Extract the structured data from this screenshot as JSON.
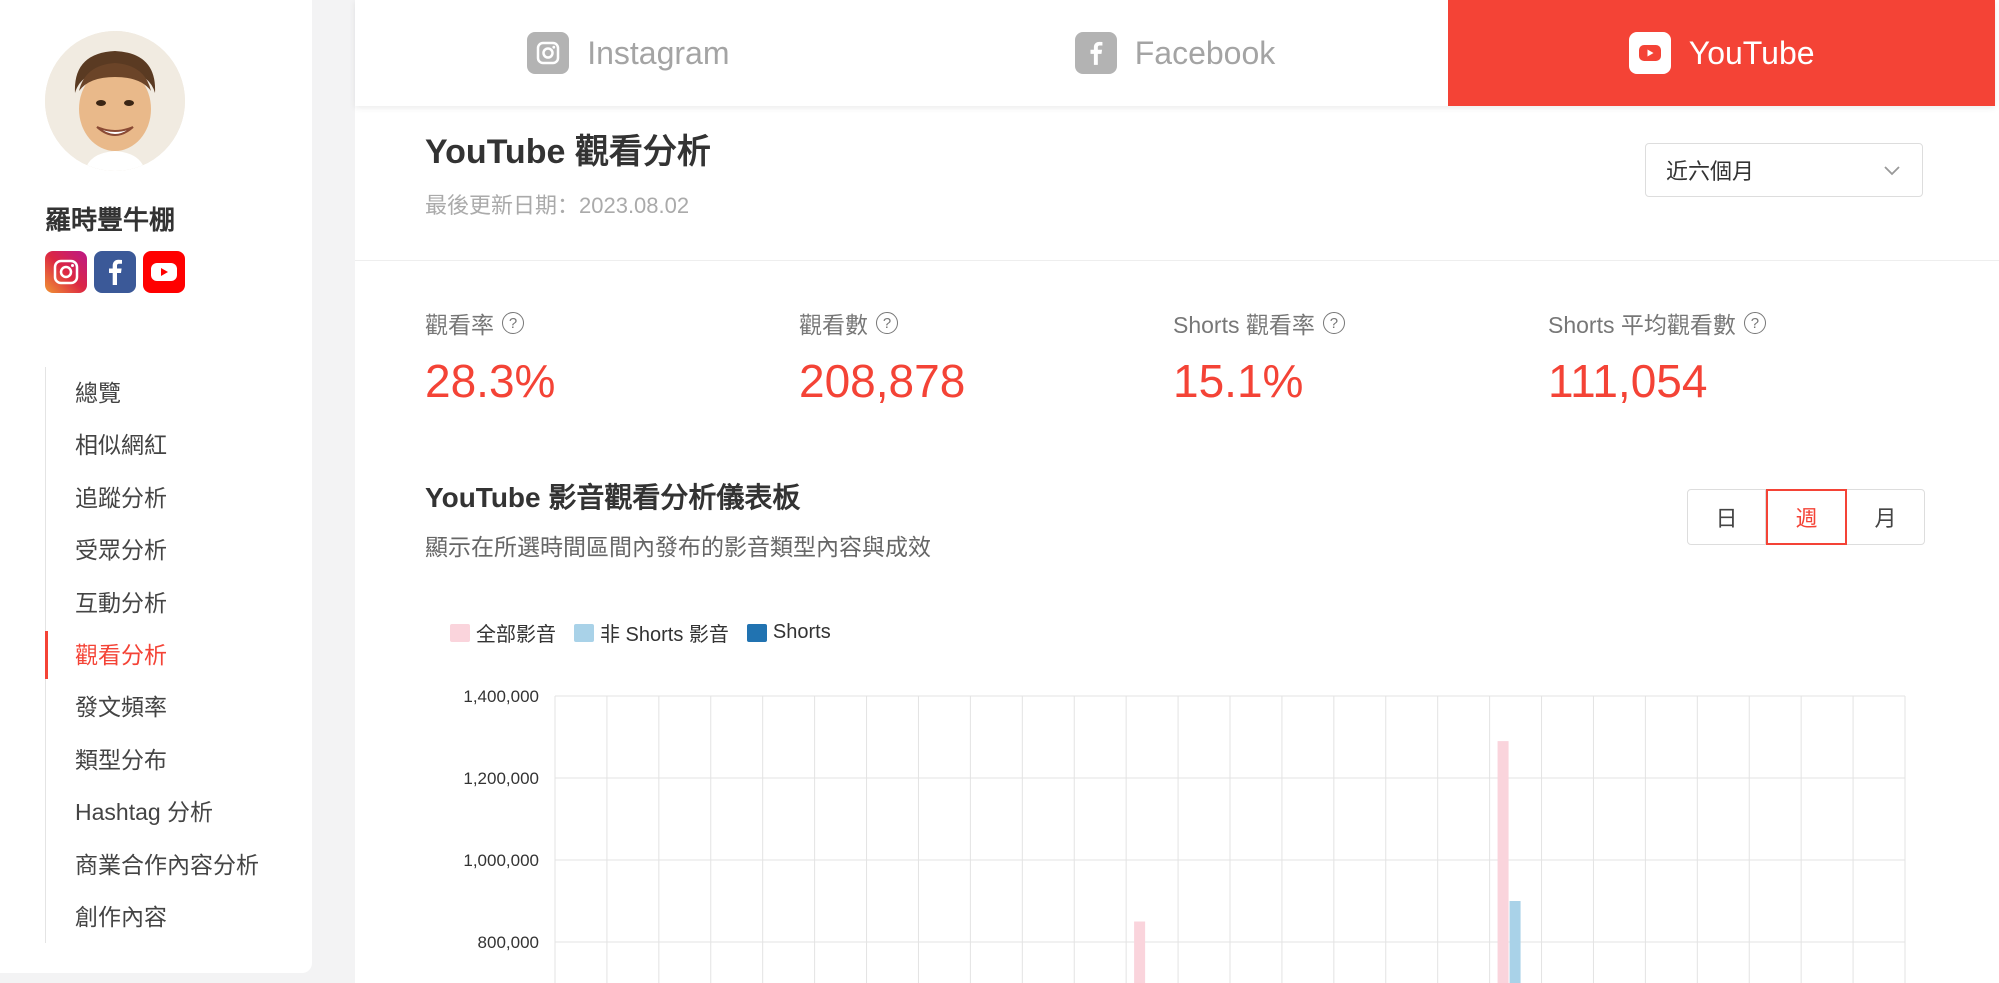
{
  "sidebar": {
    "profile_name": "羅時豐牛棚",
    "social": [
      "instagram-icon",
      "facebook-icon",
      "youtube-icon"
    ],
    "items": [
      {
        "label": "總覽"
      },
      {
        "label": "相似網紅"
      },
      {
        "label": "追蹤分析"
      },
      {
        "label": "受眾分析"
      },
      {
        "label": "互動分析"
      },
      {
        "label": "觀看分析",
        "active": true
      },
      {
        "label": "發文頻率"
      },
      {
        "label": "類型分布"
      },
      {
        "label": "Hashtag 分析"
      },
      {
        "label": "商業合作內容分析"
      },
      {
        "label": "創作內容"
      }
    ]
  },
  "tabs": [
    {
      "label": "Instagram",
      "icon": "instagram-icon"
    },
    {
      "label": "Facebook",
      "icon": "facebook-icon"
    },
    {
      "label": "YouTube",
      "icon": "youtube-icon",
      "active": true
    }
  ],
  "header": {
    "title": "YouTube 觀看分析",
    "updated": "最後更新日期：2023.08.02",
    "range": "近六個月"
  },
  "kpis": [
    {
      "label": "觀看率",
      "value": "28.3%"
    },
    {
      "label": "觀看數",
      "value": "208,878"
    },
    {
      "label": "Shorts 觀看率",
      "value": "15.1%"
    },
    {
      "label": "Shorts 平均觀看數",
      "value": "111,054"
    }
  ],
  "section": {
    "title": "YouTube 影音觀看分析儀表板",
    "subtitle": "顯示在所選時間區間內發布的影音類型內容與成效"
  },
  "granularity": {
    "options": [
      "日",
      "週",
      "月"
    ],
    "selected": "週"
  },
  "colors": {
    "accent": "#f44336",
    "all": "#fad4dc",
    "non_shorts": "#a9d2e8",
    "shorts": "#2173b1"
  },
  "chart_data": {
    "type": "bar",
    "legend": [
      "全部影音",
      "非 Shorts 影音",
      "Shorts"
    ],
    "y_ticks": [
      "1,400,000",
      "1,200,000",
      "1,000,000",
      "800,000"
    ],
    "ylim_visible": [
      700000,
      1400000
    ],
    "num_categories": 26,
    "series": [
      {
        "name": "全部影音",
        "values": [
          0,
          0,
          0,
          0,
          0,
          0,
          0,
          0,
          0,
          0,
          0,
          850000,
          0,
          0,
          0,
          0,
          0,
          0,
          1290000,
          0,
          0,
          0,
          0,
          0,
          0,
          0
        ]
      },
      {
        "name": "非 Shorts 影音",
        "values": [
          0,
          0,
          0,
          0,
          0,
          0,
          0,
          0,
          0,
          0,
          0,
          0,
          0,
          0,
          0,
          0,
          0,
          0,
          900000,
          0,
          0,
          0,
          0,
          0,
          0,
          0
        ]
      },
      {
        "name": "Shorts",
        "values": [
          0,
          0,
          0,
          0,
          0,
          0,
          0,
          0,
          0,
          0,
          0,
          0,
          0,
          0,
          0,
          0,
          0,
          0,
          0,
          0,
          0,
          0,
          0,
          0,
          0,
          0
        ]
      }
    ]
  }
}
